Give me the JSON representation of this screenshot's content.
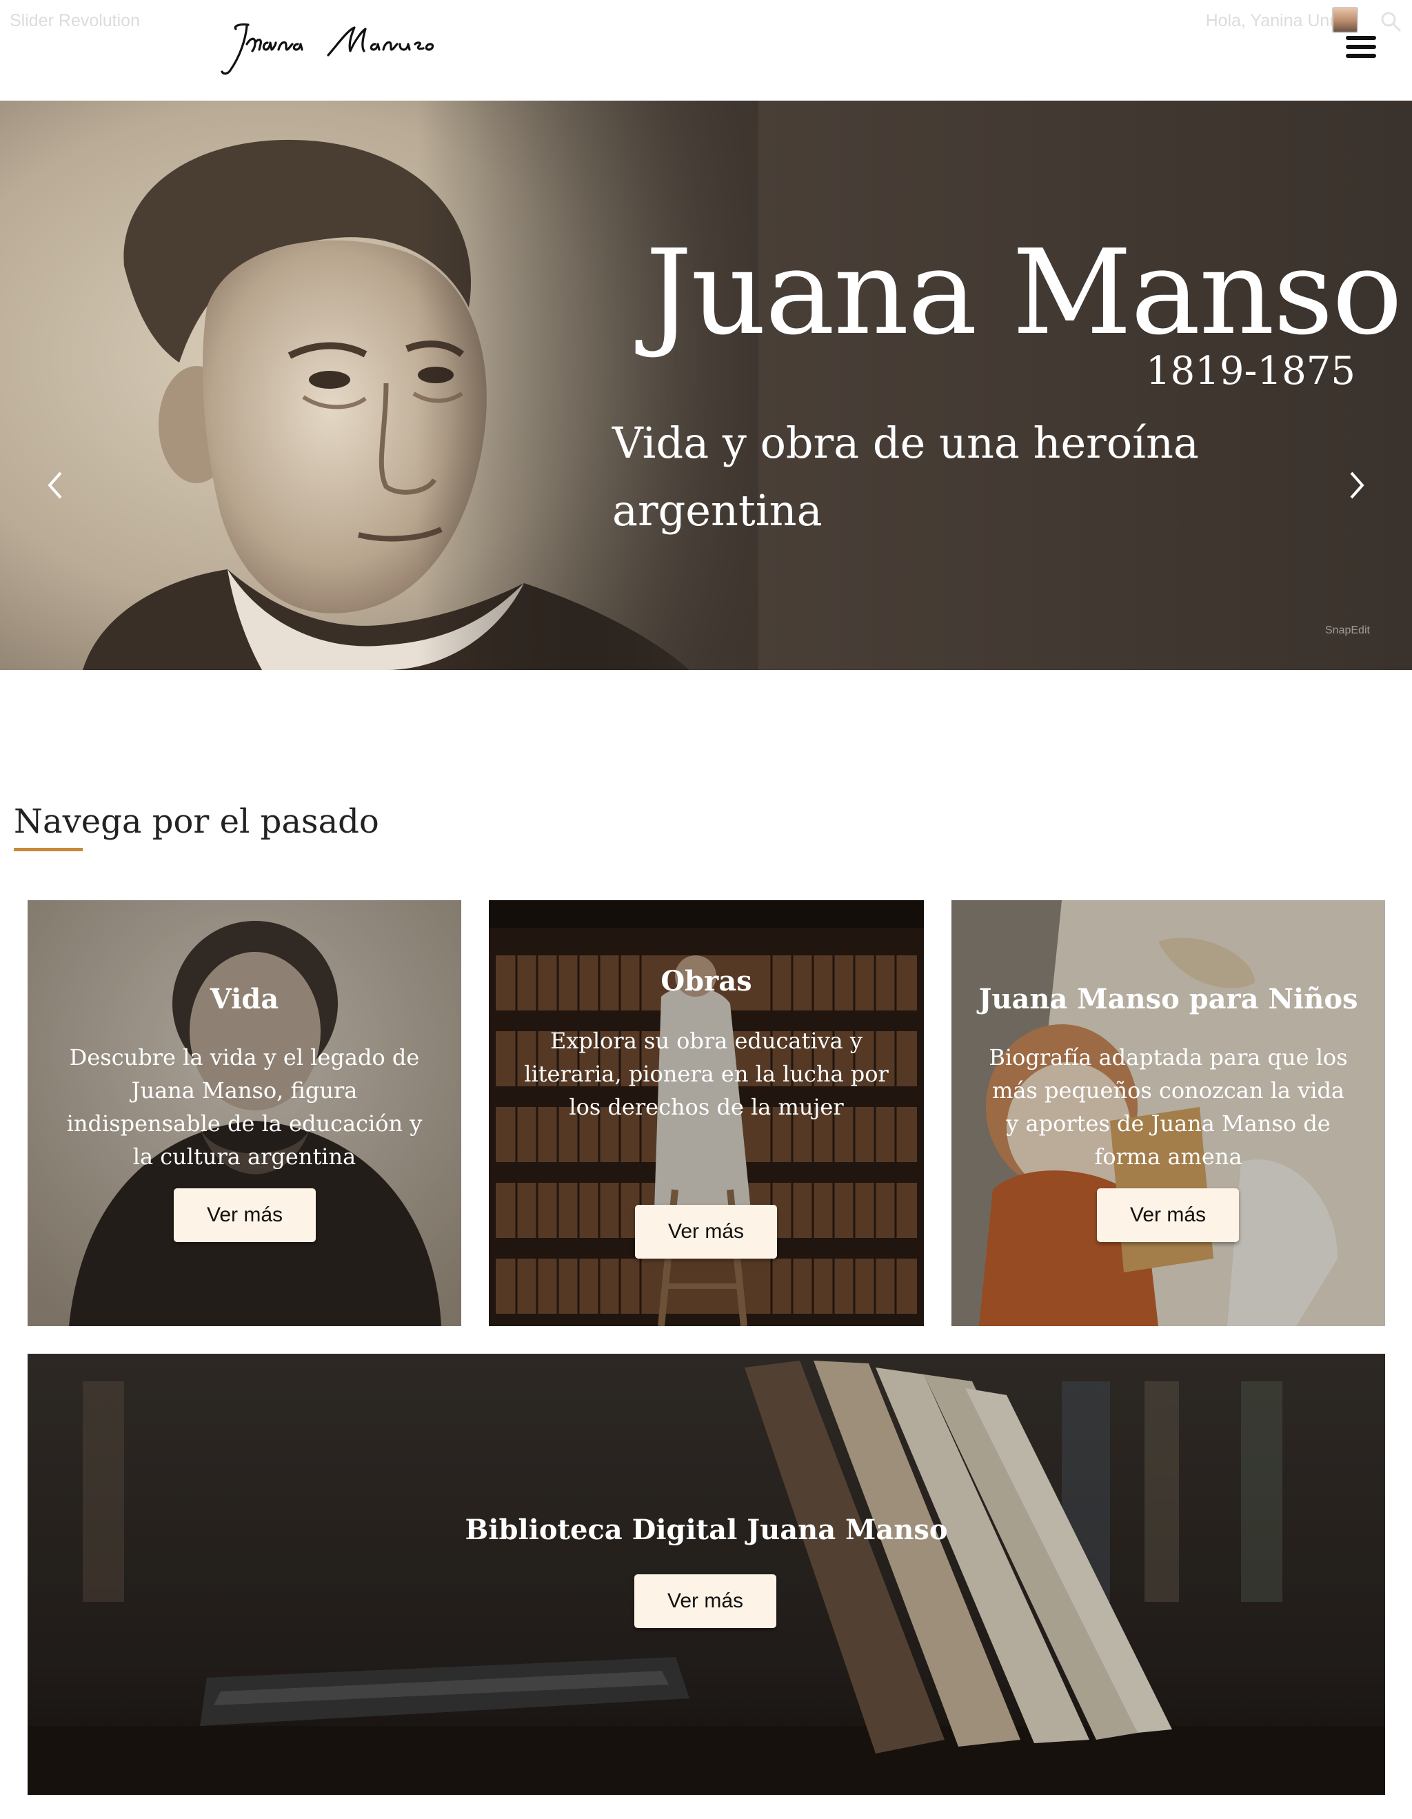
{
  "admin_bar": {
    "left_label": "Slider Revolution",
    "greeting": "Hola, Yanina Unrein"
  },
  "header": {
    "logo_alt": "Juana Manso",
    "menu_icon": "hamburger-menu-icon"
  },
  "hero": {
    "title": "Juana Manso",
    "dates": "1819-1875",
    "subtitle": "Vida y obra de una heroína argentina",
    "watermark": "SnapEdit"
  },
  "section": {
    "title": "Navega por el pasado",
    "accent_color": "#c8883a"
  },
  "cards": [
    {
      "title": "Vida",
      "description": "Descubre la vida y el legado de Juana Manso, figura indispensable de la educación y la cultura argentina",
      "button": "Ver más"
    },
    {
      "title": "Obras",
      "description": "Explora su obra educativa y literaria, pionera en la lucha por los derechos de la mujer",
      "button": "Ver más"
    },
    {
      "title": "Juana Manso para Niños",
      "description": "Biografía adaptada para que los más pequeños conozcan la vida y aportes de Juana Manso de forma amena",
      "button": "Ver más"
    }
  ],
  "banner": {
    "title": "Biblioteca Digital Juana Manso",
    "button": "Ver más"
  }
}
